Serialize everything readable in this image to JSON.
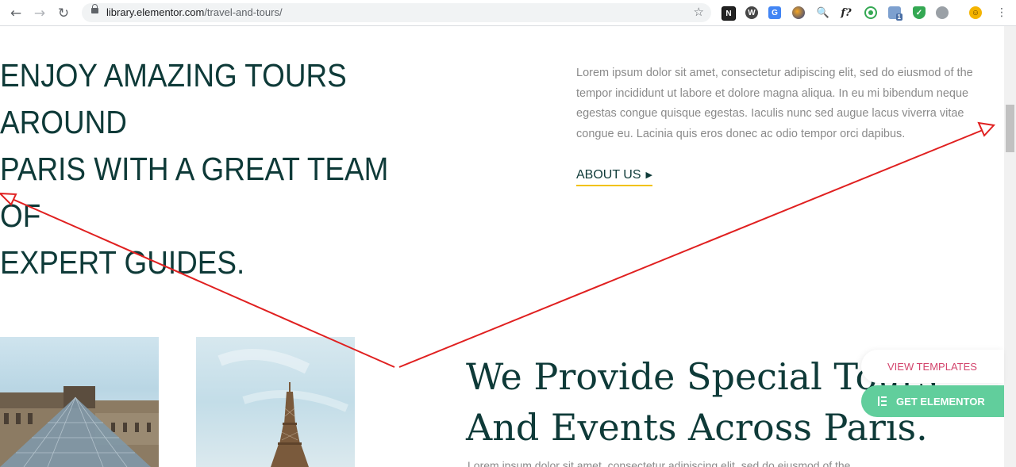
{
  "browser": {
    "url_host": "library.elementor.com",
    "url_path": "/travel-and-tours/",
    "extensions": [
      "notion-icon",
      "wordpress-icon",
      "translate-icon",
      "color-picker-icon",
      "search-ext-icon",
      "font-identifier-icon",
      "record-icon",
      "mail-notifier-icon",
      "shield-icon",
      "globe-icon",
      "emoji-icon"
    ],
    "mail_badge": "1"
  },
  "hero": {
    "title_lines": [
      "ENJOY AMAZING TOURS AROUND",
      "PARIS WITH A GREAT TEAM OF",
      "EXPERT GUIDES."
    ],
    "paragraph": "Lorem ipsum dolor sit amet, consectetur adipiscing elit, sed do eiusmod of the tempor incididunt ut labore et dolore magna aliqua. In eu mi bibendum neque egestas congue quisque egestas. Iaculis nunc sed augue lacus viverra vitae congue eu. Lacinia quis eros donec ac odio tempor orci dapibus.",
    "about_label": "ABOUT US",
    "about_arrow": "▶"
  },
  "section": {
    "title_line1": "We Provide Special Tours",
    "title_line2": "And Events Across Paris.",
    "sub": "Lorem ipsum dolor sit amet, consectetur adipiscing elit, sed do eiusmod of the tempor"
  },
  "floating": {
    "view_templates": "VIEW TEMPLATES",
    "get_elementor": "GET ELEMENTOR"
  },
  "colors": {
    "heading": "#0e3a38",
    "accent_underline": "#f2c200",
    "annotation_arrow": "#e02020",
    "view_templates": "#d3456d",
    "get_elementor_bg": "#61ce9c"
  }
}
